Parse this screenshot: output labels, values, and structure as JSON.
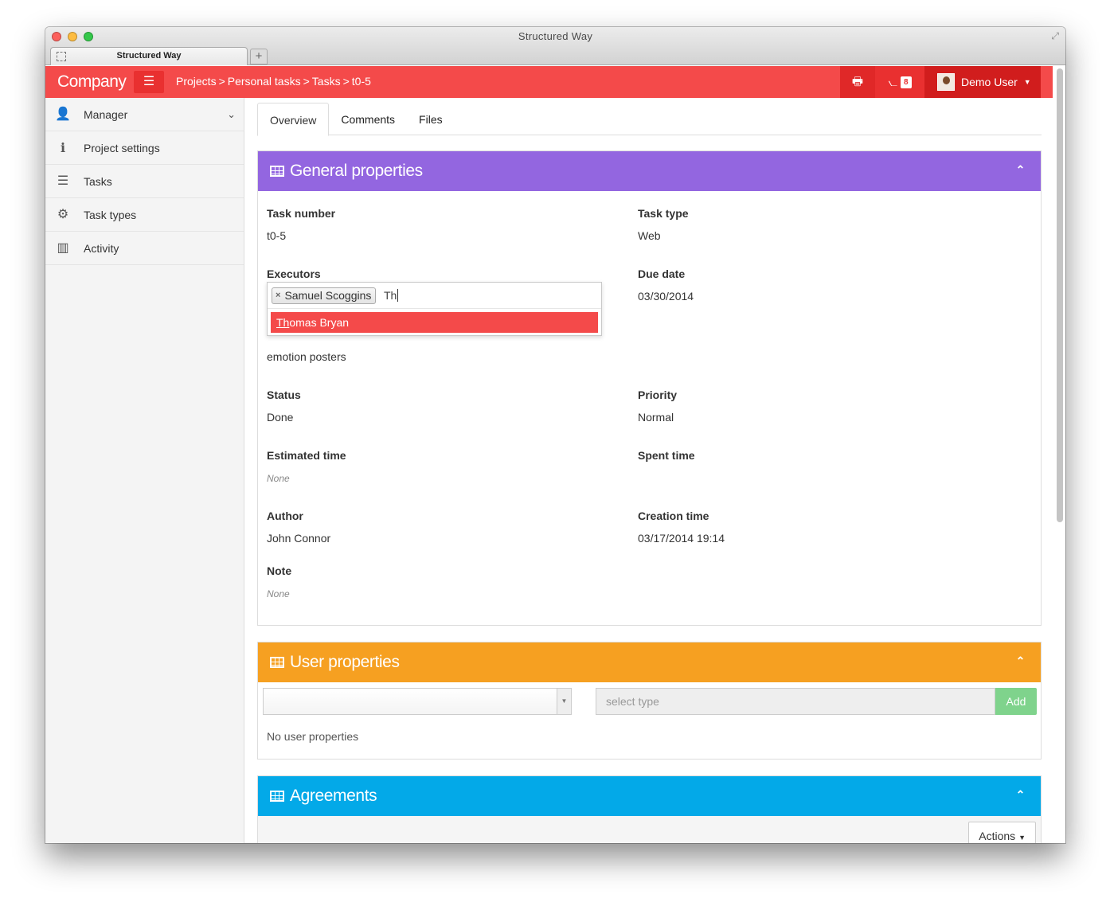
{
  "window": {
    "title": "Structured Way",
    "tab_label": "Structured Way",
    "new_tab_symbol": "+"
  },
  "navbar": {
    "brand": "Company",
    "breadcrumb": [
      "Projects",
      "Personal tasks",
      "Tasks",
      "t0-5"
    ],
    "breadcrumb_sep": ">",
    "feed_count": "8",
    "user_name": "Demo User",
    "accent_color": "#f44a4a"
  },
  "sidebar": {
    "items": [
      {
        "label": "Manager",
        "icon": "user-icon"
      },
      {
        "label": "Project settings",
        "icon": "info-icon"
      },
      {
        "label": "Tasks",
        "icon": "tasks-icon"
      },
      {
        "label": "Task types",
        "icon": "gear-icon"
      },
      {
        "label": "Activity",
        "icon": "bar-chart-icon"
      }
    ]
  },
  "tabs": [
    "Overview",
    "Comments",
    "Files"
  ],
  "general": {
    "title": "General properties",
    "color": "#9366e0",
    "task_number_label": "Task number",
    "task_number": "t0-5",
    "task_type_label": "Task type",
    "task_type": "Web",
    "executors_label": "Executors",
    "executor_chip": "Samuel Scoggins",
    "executor_typed": "Th",
    "suggestion_match": "Th",
    "suggestion_rest": "omas Bryan",
    "due_date_label": "Due date",
    "due_date": "03/30/2014",
    "content": "emotion posters",
    "status_label": "Status",
    "status": "Done",
    "priority_label": "Priority",
    "priority": "Normal",
    "estimated_label": "Estimated time",
    "estimated": "None",
    "spent_label": "Spent time",
    "author_label": "Author",
    "author": "John Connor",
    "creation_label": "Creation time",
    "creation": "03/17/2014 19:14",
    "note_label": "Note",
    "note": "None"
  },
  "user_props": {
    "title": "User properties",
    "color": "#f6a021",
    "type_placeholder": "select type",
    "add_label": "Add",
    "empty_text": "No user properties"
  },
  "agreements": {
    "title": "Agreements",
    "color": "#03a9e8",
    "actions_label": "Actions"
  }
}
